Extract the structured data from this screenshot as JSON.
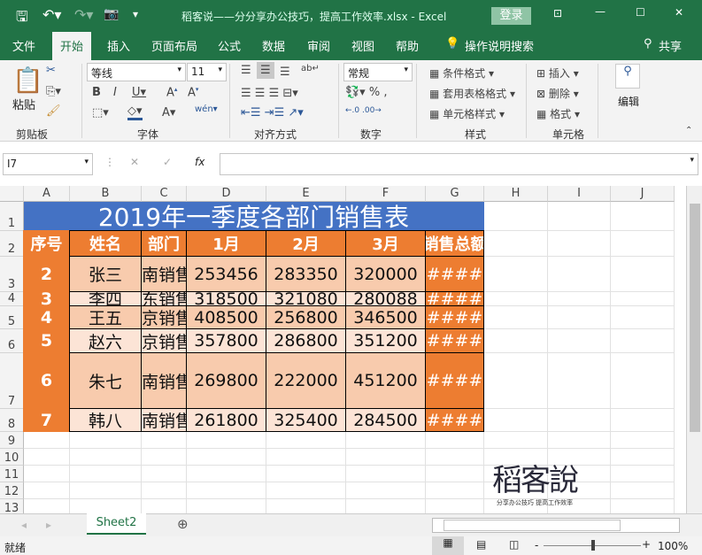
{
  "titlebar": {
    "title": "稻客说——分分享办公技巧，提高工作效率.xlsx  -  Excel",
    "login": "登录"
  },
  "tabs": [
    "文件",
    "开始",
    "插入",
    "页面布局",
    "公式",
    "数据",
    "审阅",
    "视图",
    "帮助"
  ],
  "tell_me": "操作说明搜索",
  "share": "共享",
  "ribbon": {
    "paste": "粘贴",
    "font_name": "等线",
    "font_size": "11",
    "number_format": "常规",
    "conditional": "条件格式",
    "table_format": "套用表格格式",
    "cell_style": "单元格样式",
    "insert": "插入",
    "delete": "删除",
    "format": "格式",
    "edit": "编辑",
    "groups": [
      "剪贴板",
      "字体",
      "对齐方式",
      "数字",
      "样式",
      "单元格"
    ]
  },
  "formula": {
    "name_box": "I7",
    "fx": "fx",
    "value": ""
  },
  "columns": [
    "A",
    "B",
    "C",
    "D",
    "E",
    "F",
    "G",
    "H",
    "I",
    "J"
  ],
  "rows": [
    "1",
    "2",
    "3",
    "4",
    "5",
    "6",
    "7",
    "8",
    "9",
    "10",
    "11",
    "12",
    "13"
  ],
  "sheet": {
    "title": "2019年一季度各部门销售表",
    "headers": [
      "序号",
      "姓名",
      "部门",
      "1月",
      "2月",
      "3月",
      "销售总额"
    ],
    "data": [
      [
        "2",
        "张三",
        "南销售",
        "253456",
        "283350",
        "320000",
        "####"
      ],
      [
        "3",
        "李四",
        "东销售",
        "318500",
        "321080",
        "280088",
        "####"
      ],
      [
        "4",
        "王五",
        "京销售",
        "408500",
        "256800",
        "346500",
        "####"
      ],
      [
        "5",
        "赵六",
        "京销售",
        "357800",
        "286800",
        "351200",
        "####"
      ],
      [
        "6",
        "朱七",
        "南销售",
        "269800",
        "222000",
        "451200",
        "####"
      ],
      [
        "7",
        "韩八",
        "南销售",
        "261800",
        "325400",
        "284500",
        "####"
      ]
    ]
  },
  "watermark": {
    "logo": "稻客說",
    "slogan": "分享办公技巧 提高工作效率"
  },
  "sheet_tab": "Sheet2",
  "status": {
    "ready": "就绪",
    "zoom": "100%"
  },
  "colors": {
    "green": "#217346",
    "blue": "#4472C4",
    "orange": "#ED7D31",
    "peach": "#F8CBAD",
    "light": "#FCE4D6"
  }
}
